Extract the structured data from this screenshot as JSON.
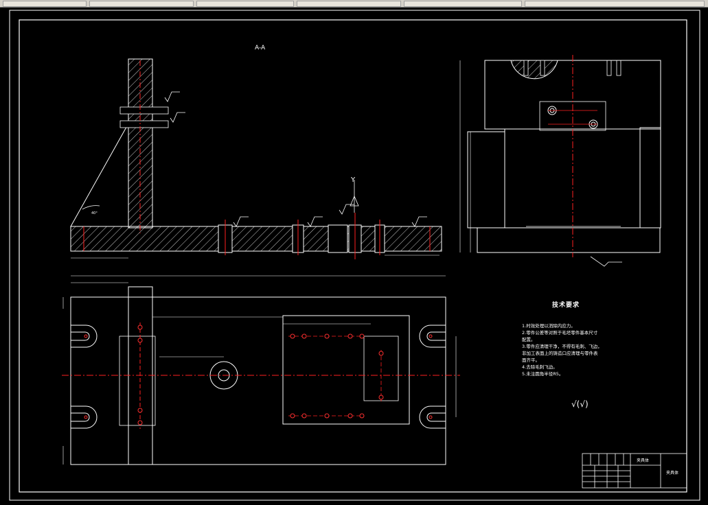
{
  "window": {
    "toolbar_segments": 6
  },
  "drawing": {
    "section_label": "A-A",
    "datum_label": "Y",
    "angle_label": "40°",
    "technical_requirements": {
      "title": "技术要求",
      "items": [
        "1.时效处理以消除内应力。",
        "2.零件公差等对照于毛坯零件基本尺寸",
        "配置。",
        "3.零件应清理干净，不得有毛刺、飞边，",
        "非加工表面上的铸造口应清理与零件表",
        "面齐平。",
        "4.去除毛刺飞边。",
        "5.未注圆角半径R5。"
      ]
    },
    "surface_symbol": "√(√)",
    "title_block": {
      "part_name": "夹具体",
      "drawing_name": "夹具体"
    },
    "colors": {
      "background": "#000000",
      "lines": "#ffffff",
      "centerline": "#ff2020",
      "toolbar": "#d4d0c8"
    }
  }
}
